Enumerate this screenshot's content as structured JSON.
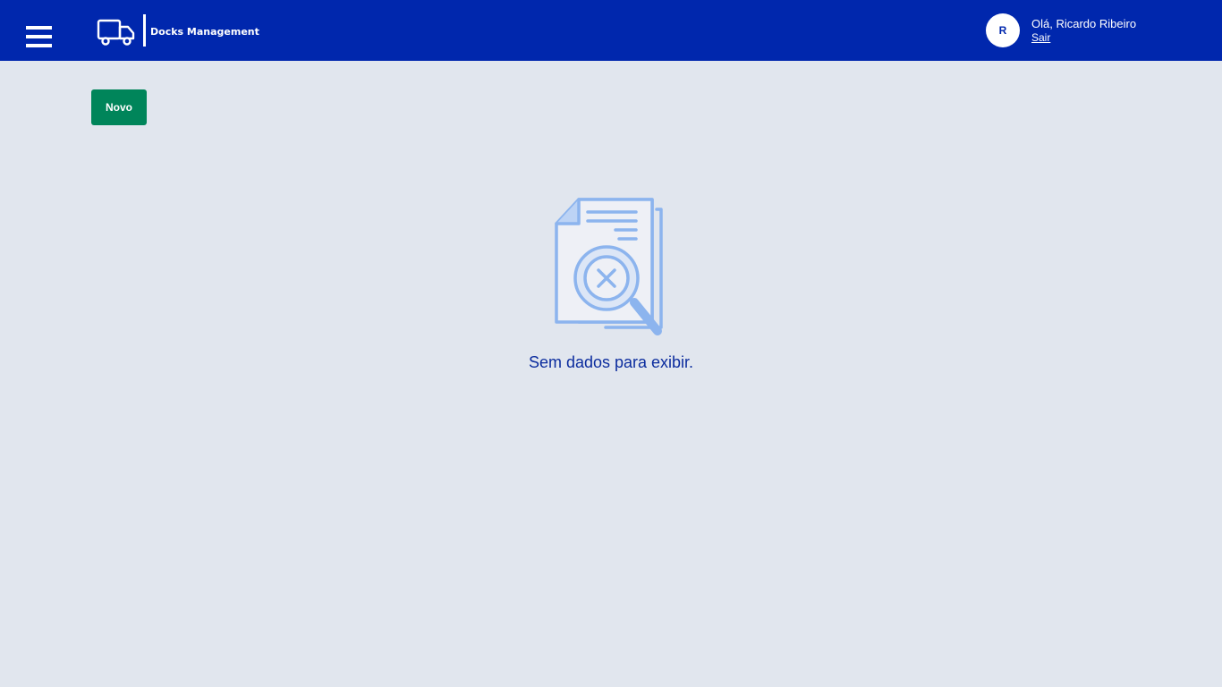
{
  "header": {
    "menu_icon": "hamburger-menu-icon",
    "logo_icon": "truck-icon",
    "app_name": "Docks Management",
    "user": {
      "avatar_initial": "R",
      "greeting": "Olá, Ricardo Ribeiro",
      "logout_label": "Sair"
    },
    "colors": {
      "bar": "#0027ad",
      "text": "#ffffff"
    }
  },
  "toolbar": {
    "new_label": "Novo",
    "new_color": "#00855a"
  },
  "empty_state": {
    "icon": "document-search-no-results-icon",
    "message": "Sem dados para exibir."
  },
  "page": {
    "background": "#e1e6ee"
  }
}
